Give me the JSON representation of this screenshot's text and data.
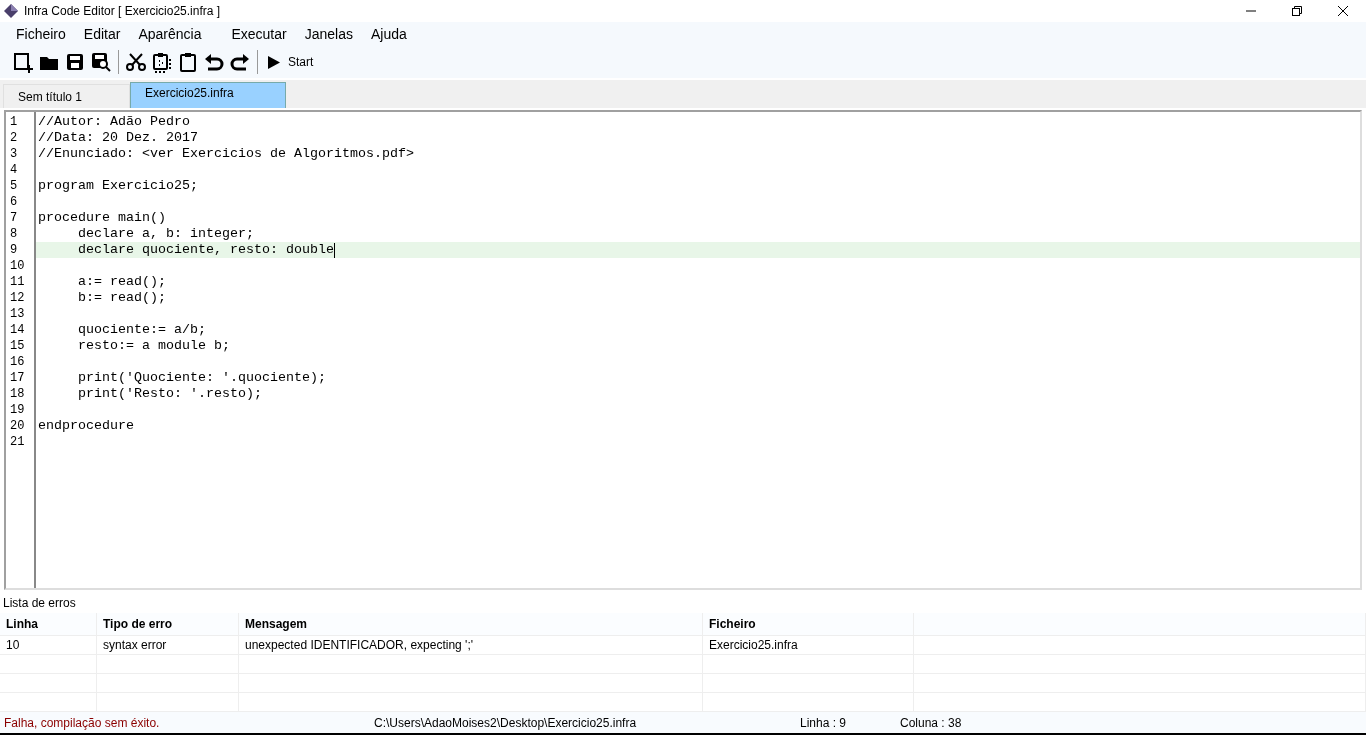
{
  "window": {
    "title": "Infra Code Editor [ Exercicio25.infra ]"
  },
  "menu": [
    "Ficheiro",
    "Editar",
    "Aparência",
    "Executar",
    "Janelas",
    "Ajuda"
  ],
  "toolbar": {
    "start_label": "Start"
  },
  "tabs": [
    {
      "label": "Sem título 1",
      "selected": false
    },
    {
      "label": "Exercicio25.infra",
      "selected": true
    }
  ],
  "editor": {
    "lines": [
      {
        "number": "1",
        "text": "//Autor: Adão Pedro",
        "current": false
      },
      {
        "number": "2",
        "text": "//Data: 20 Dez. 2017",
        "current": false
      },
      {
        "number": "3",
        "text": "//Enunciado: <ver Exercicios de Algoritmos.pdf>",
        "current": false
      },
      {
        "number": "4",
        "current": false
      },
      {
        "number": "5",
        "text": "program Exercicio25;",
        "current": false
      },
      {
        "number": "6",
        "current": false
      },
      {
        "number": "7",
        "text": "procedure main()",
        "current": false
      },
      {
        "number": "8",
        "text": "     declare a, b: integer;",
        "current": false
      },
      {
        "number": "9",
        "text": "     declare quociente, resto: double",
        "current": true
      },
      {
        "number": "10",
        "current": false
      },
      {
        "number": "11",
        "text": "     a:= read();",
        "current": false
      },
      {
        "number": "12",
        "text": "     b:= read();",
        "current": false
      },
      {
        "number": "13",
        "current": false
      },
      {
        "number": "14",
        "text": "     quociente:= a/b;",
        "current": false
      },
      {
        "number": "15",
        "text": "     resto:= a module b;",
        "current": false
      },
      {
        "number": "16",
        "current": false
      },
      {
        "number": "17",
        "text": "     print('Quociente: '.quociente);",
        "current": false
      },
      {
        "number": "18",
        "text": "     print('Resto: '.resto);",
        "current": false
      },
      {
        "number": "19",
        "current": false
      },
      {
        "number": "20",
        "text": "endprocedure",
        "current": false
      },
      {
        "number": "21",
        "current": false
      }
    ]
  },
  "errors": {
    "title": "Lista de erros",
    "columns": [
      "Linha",
      "Tipo de erro",
      "Mensagem",
      "Ficheiro"
    ],
    "rows": [
      {
        "line": "10",
        "type": "syntax error",
        "message": "unexpected IDENTIFICADOR, expecting ';'",
        "file": "Exercicio25.infra"
      }
    ]
  },
  "status_bar": {
    "message": "Falha, compilação sem éxito.",
    "path": "C:\\Users\\AdaoMoises2\\Desktop\\Exercicio25.infra",
    "line": "Linha : 9",
    "column": "Coluna : 38"
  }
}
